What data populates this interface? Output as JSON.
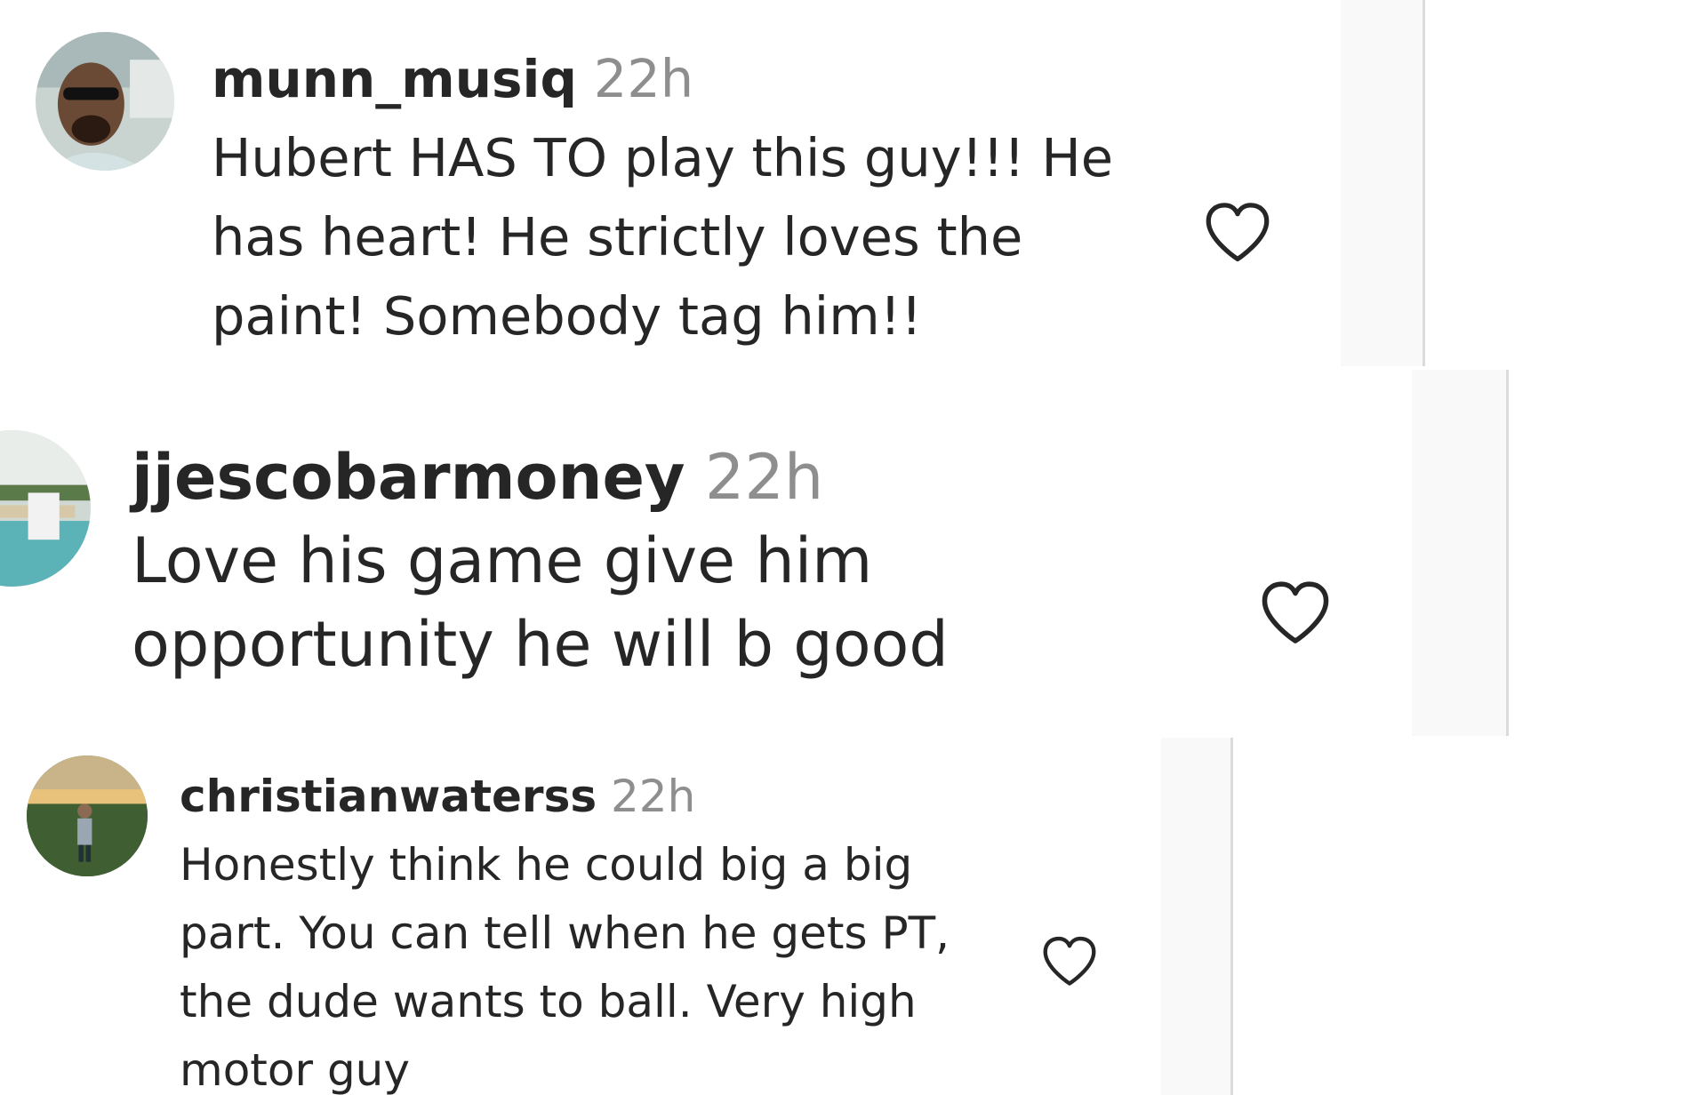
{
  "comments": [
    {
      "username": "munn_musiq",
      "timestamp": "22h",
      "text": "Hubert HAS TO play this guy!!! He has heart! He strictly loves the paint! Somebody tag him!!",
      "like_icon": "heart-outline-icon"
    },
    {
      "username": "jjescobarmoney",
      "timestamp": "22h",
      "text": "Love his game give him opportunity he will b good",
      "like_icon": "heart-outline-icon"
    },
    {
      "username": "christianwaterss",
      "timestamp": "22h",
      "text": "Honestly think he could big a big part. You can tell when he gets PT, the dude wants to ball. Very high motor guy",
      "like_icon": "heart-outline-icon"
    }
  ],
  "colors": {
    "text": "#262626",
    "timestamp": "#8e8e8e",
    "divider": "#dbdbdb",
    "heart_outline": "#262626"
  }
}
